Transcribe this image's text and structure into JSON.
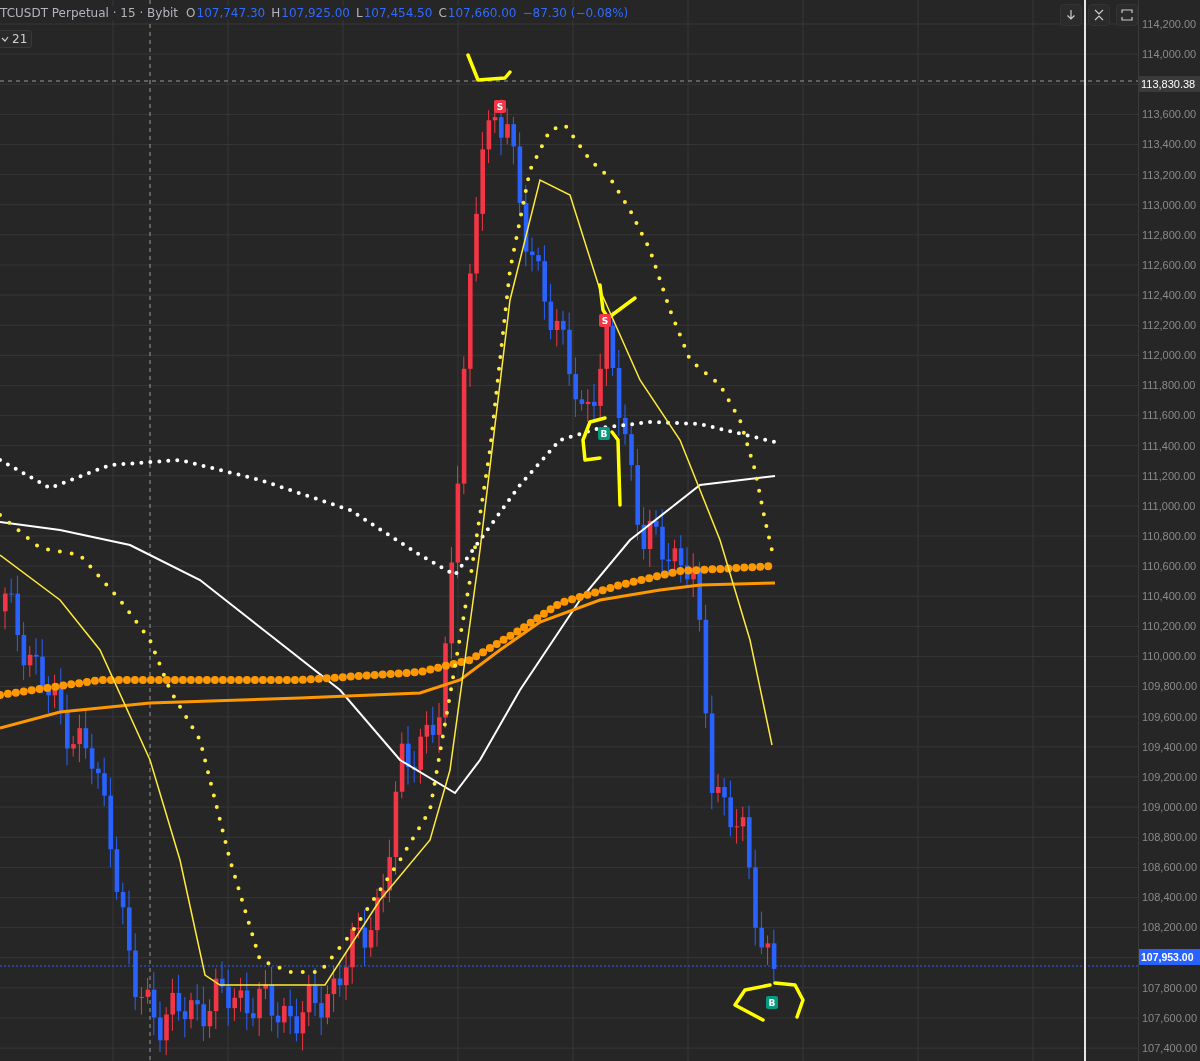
{
  "legend": {
    "symbol": "TCUSDT Perpetual · 15 · Bybit",
    "ohlc": [
      {
        "key": "O",
        "value": "107,747.30"
      },
      {
        "key": "H",
        "value": "107,925.00"
      },
      {
        "key": "L",
        "value": "107,454.50"
      },
      {
        "key": "C",
        "value": "107,660.00"
      }
    ],
    "change": "−87.30 (−0.08%)",
    "indicator_count": "21"
  },
  "price_axis": [
    {
      "kind": "tick",
      "label": "114,200.00"
    },
    {
      "kind": "tick",
      "label": "114,000.00"
    },
    {
      "kind": "crosshair",
      "label": "113,830.38"
    },
    {
      "kind": "tick",
      "label": "113,600.00"
    },
    {
      "kind": "tick",
      "label": "113,400.00"
    },
    {
      "kind": "tick",
      "label": "113,200.00"
    },
    {
      "kind": "tick",
      "label": "113,000.00"
    },
    {
      "kind": "tick",
      "label": "112,800.00"
    },
    {
      "kind": "tick",
      "label": "112,600.00"
    },
    {
      "kind": "tick",
      "label": "112,400.00"
    },
    {
      "kind": "tick",
      "label": "112,200.00"
    },
    {
      "kind": "tick",
      "label": "112,000.00"
    },
    {
      "kind": "tick",
      "label": "111,800.00"
    },
    {
      "kind": "tick",
      "label": "111,600.00"
    },
    {
      "kind": "tick",
      "label": "111,400.00"
    },
    {
      "kind": "tick",
      "label": "111,200.00"
    },
    {
      "kind": "tick",
      "label": "111,000.00"
    },
    {
      "kind": "tick",
      "label": "110,800.00"
    },
    {
      "kind": "tick",
      "label": "110,600.00"
    },
    {
      "kind": "tick",
      "label": "110,400.00"
    },
    {
      "kind": "tick",
      "label": "110,200.00"
    },
    {
      "kind": "tick",
      "label": "110,000.00"
    },
    {
      "kind": "tick",
      "label": "109,800.00"
    },
    {
      "kind": "tick",
      "label": "109,600.00"
    },
    {
      "kind": "tick",
      "label": "109,400.00"
    },
    {
      "kind": "tick",
      "label": "109,200.00"
    },
    {
      "kind": "tick",
      "label": "109,000.00"
    },
    {
      "kind": "tick",
      "label": "108,800.00"
    },
    {
      "kind": "tick",
      "label": "108,600.00"
    },
    {
      "kind": "tick",
      "label": "108,400.00"
    },
    {
      "kind": "tick",
      "label": "108,200.00"
    },
    {
      "kind": "last",
      "label": "107,953.00"
    },
    {
      "kind": "tick",
      "label": "107,800.00"
    },
    {
      "kind": "tick",
      "label": "107,600.00"
    },
    {
      "kind": "tick",
      "label": "107,400.00"
    }
  ],
  "signals": [
    {
      "kind": "sell",
      "label": "S"
    },
    {
      "kind": "sell",
      "label": "S"
    },
    {
      "kind": "buy",
      "label": "B"
    },
    {
      "kind": "buy",
      "label": "B"
    }
  ]
}
